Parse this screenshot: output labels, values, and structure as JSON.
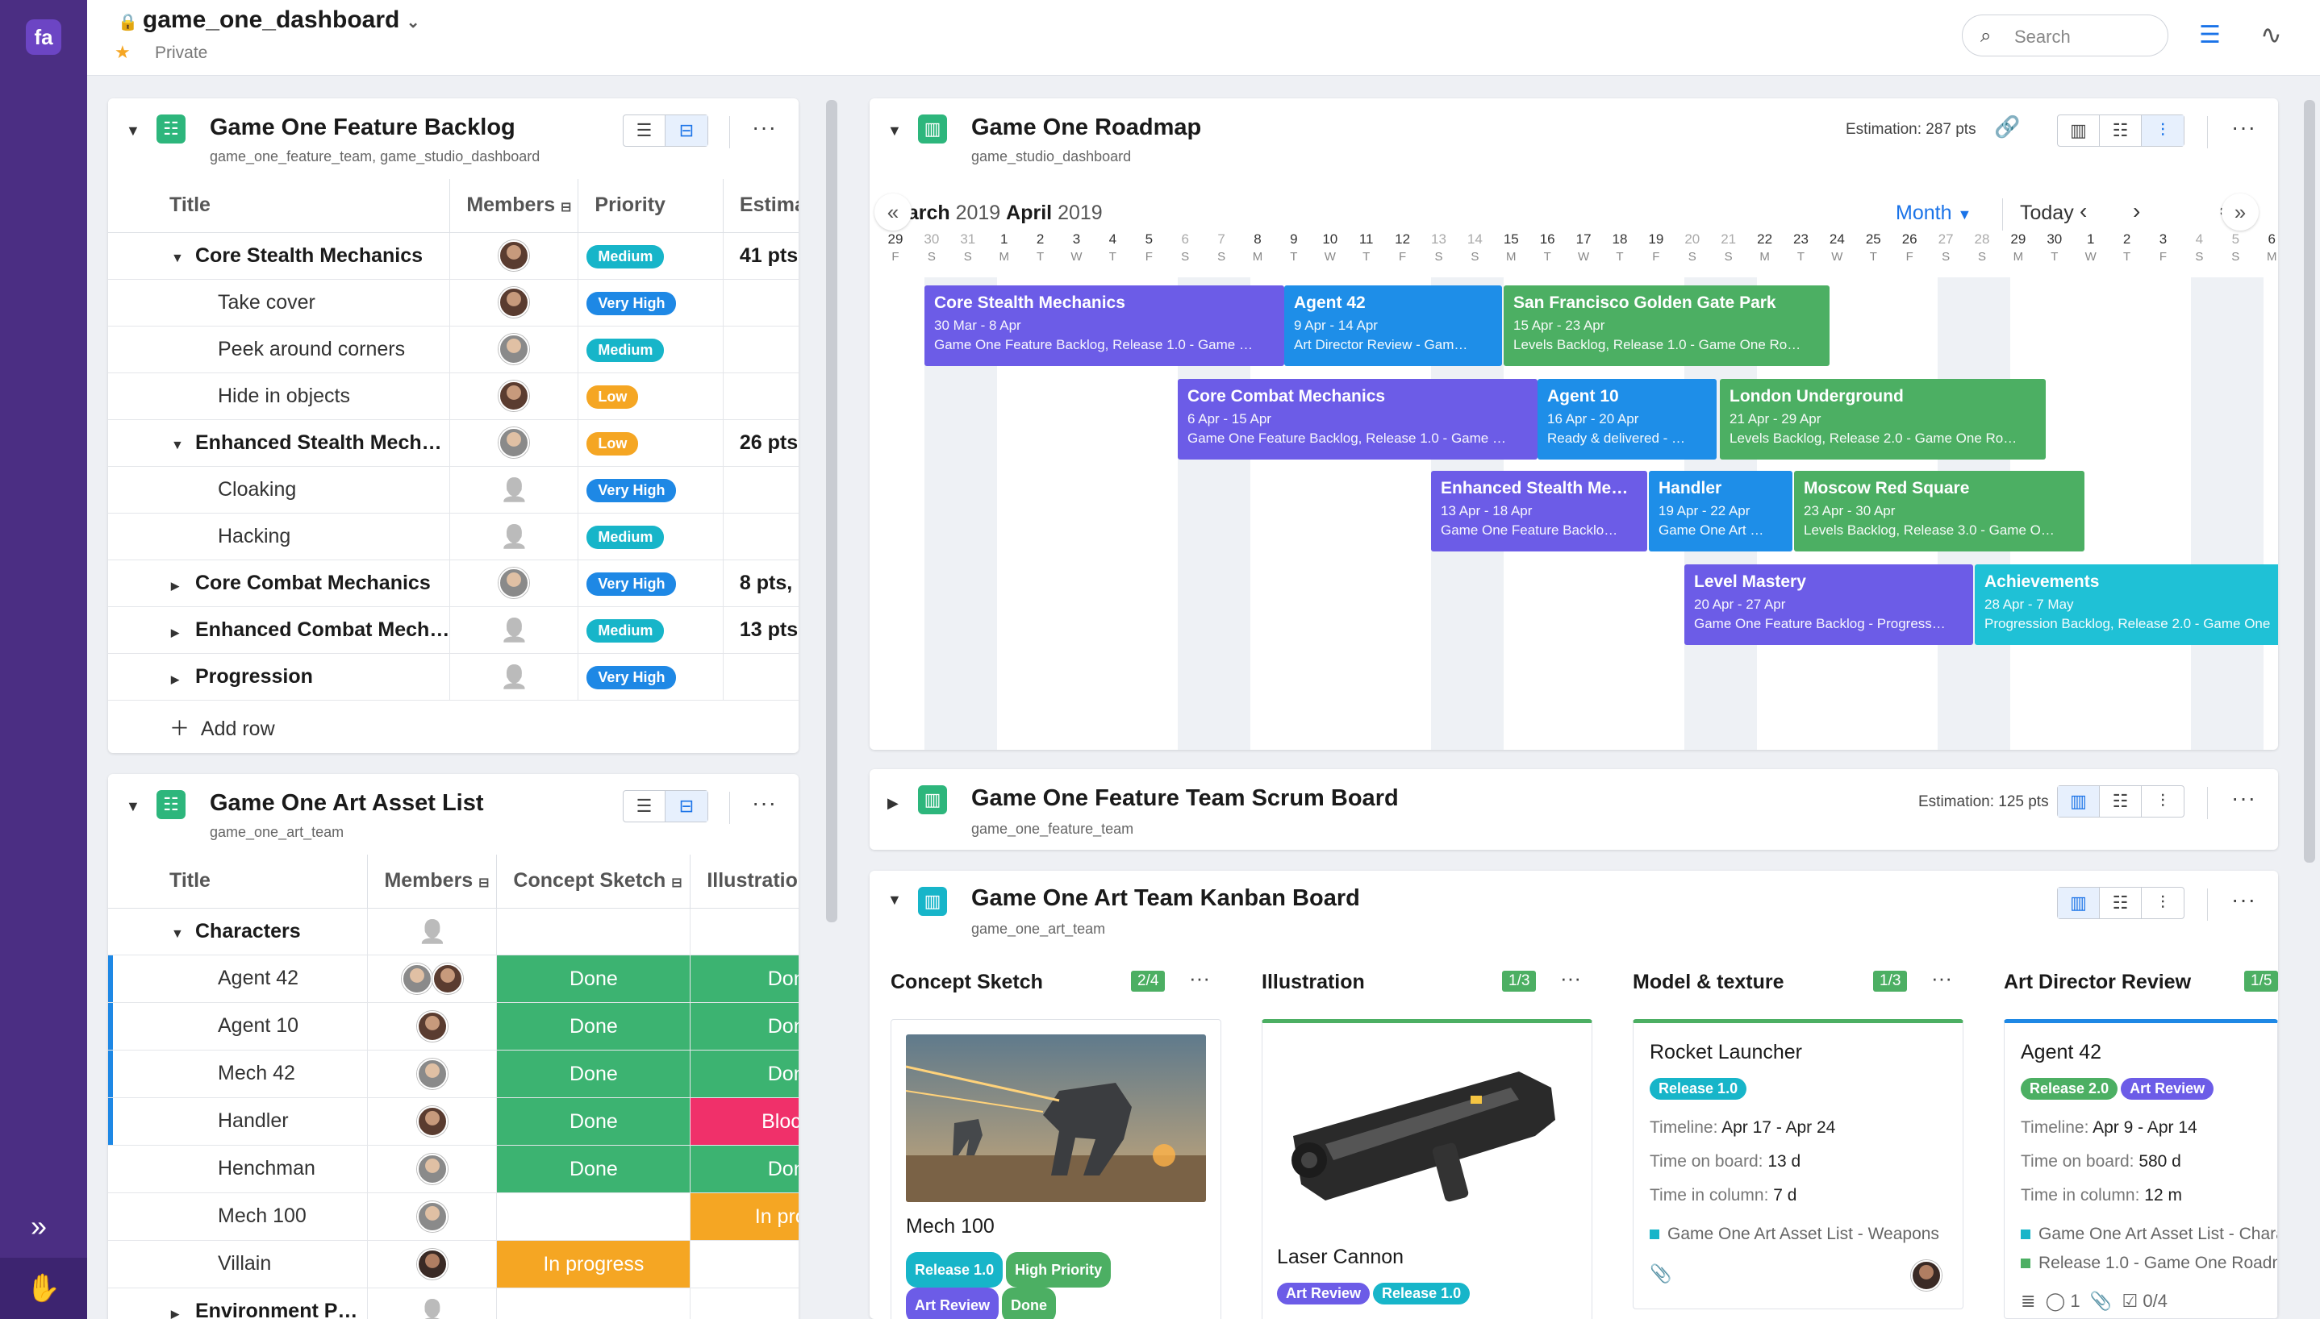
{
  "app": {
    "logo": "fa",
    "dashboard_title": "game_one_dashboard",
    "privacy": "Private",
    "search_placeholder": "Search"
  },
  "backlog": {
    "title": "Game One Feature Backlog",
    "subtitle": "game_one_feature_team, game_studio_dashboard",
    "columns": [
      "Title",
      "Members",
      "Priority",
      "Estimat"
    ],
    "rows": [
      {
        "title": "Core Stealth Mechanics",
        "parent": true,
        "expanded": true,
        "priority": "Medium",
        "est": "41 pts,"
      },
      {
        "title": "Take cover",
        "priority": "Very High"
      },
      {
        "title": "Peek around corners",
        "priority": "Medium"
      },
      {
        "title": "Hide in objects",
        "priority": "Low"
      },
      {
        "title": "Enhanced Stealth Mech…",
        "parent": true,
        "expanded": true,
        "priority": "Low",
        "est": "26 pts,"
      },
      {
        "title": "Cloaking",
        "priority": "Very High"
      },
      {
        "title": "Hacking",
        "priority": "Medium"
      },
      {
        "title": "Core Combat Mechanics",
        "parent": true,
        "priority": "Very High",
        "est": "8 pts,"
      },
      {
        "title": "Enhanced Combat Mech…",
        "parent": true,
        "priority": "Medium",
        "est": "13 pts,"
      },
      {
        "title": "Progression",
        "parent": true,
        "priority": "Very High"
      }
    ],
    "add_row": "Add row"
  },
  "art_list": {
    "title": "Game One Art Asset List",
    "subtitle": "game_one_art_team",
    "columns": [
      "Title",
      "Members",
      "Concept Sketch",
      "Illustration"
    ],
    "rows": [
      {
        "title": "Characters",
        "parent": true,
        "sketch": "",
        "illus": ""
      },
      {
        "title": "Agent 42",
        "sketch": "Done",
        "illus": "Don"
      },
      {
        "title": "Agent 10",
        "sketch": "Done",
        "illus": "Don"
      },
      {
        "title": "Mech 42",
        "sketch": "Done",
        "illus": "Don"
      },
      {
        "title": "Handler",
        "sketch": "Done",
        "illus": "Block"
      },
      {
        "title": "Henchman",
        "sketch": "Done",
        "illus": "Don"
      },
      {
        "title": "Mech 100",
        "sketch": "",
        "illus": "In prog"
      },
      {
        "title": "Villain",
        "sketch": "In progress",
        "illus": ""
      },
      {
        "title": "Environment P…",
        "parent": true,
        "sketch": "",
        "illus": ""
      }
    ]
  },
  "roadmap": {
    "title": "Game One Roadmap",
    "subtitle": "game_studio_dashboard",
    "estimation": "Estimation: 287 pts",
    "month_a": "March",
    "year_a": "2019",
    "month_b": "April",
    "year_b": "2019",
    "scale": "Month",
    "today": "Today",
    "days": [
      [
        "29",
        "F"
      ],
      [
        "30",
        "S"
      ],
      [
        "31",
        "S"
      ],
      [
        "1",
        "M"
      ],
      [
        "2",
        "T"
      ],
      [
        "3",
        "W"
      ],
      [
        "4",
        "T"
      ],
      [
        "5",
        "F"
      ],
      [
        "6",
        "S"
      ],
      [
        "7",
        "S"
      ],
      [
        "8",
        "M"
      ],
      [
        "9",
        "T"
      ],
      [
        "10",
        "W"
      ],
      [
        "11",
        "T"
      ],
      [
        "12",
        "F"
      ],
      [
        "13",
        "S"
      ],
      [
        "14",
        "S"
      ],
      [
        "15",
        "M"
      ],
      [
        "16",
        "T"
      ],
      [
        "17",
        "W"
      ],
      [
        "18",
        "T"
      ],
      [
        "19",
        "F"
      ],
      [
        "20",
        "S"
      ],
      [
        "21",
        "S"
      ],
      [
        "22",
        "M"
      ],
      [
        "23",
        "T"
      ],
      [
        "24",
        "W"
      ],
      [
        "25",
        "T"
      ],
      [
        "26",
        "F"
      ],
      [
        "27",
        "S"
      ],
      [
        "28",
        "S"
      ],
      [
        "29",
        "M"
      ],
      [
        "30",
        "T"
      ],
      [
        "1",
        "W"
      ],
      [
        "2",
        "T"
      ],
      [
        "3",
        "F"
      ],
      [
        "4",
        "S"
      ],
      [
        "5",
        "S"
      ],
      [
        "6",
        "M"
      ]
    ],
    "bars": [
      {
        "title": "Core Stealth Mechanics",
        "dates": "30 Mar - 8 Apr",
        "sub": "Game One Feature Backlog, Release 1.0 - Game …",
        "color": "#6c5ce7"
      },
      {
        "title": "Agent 42",
        "dates": "9 Apr - 14 Apr",
        "sub": "Art Director Review - Gam…",
        "color": "#1e8ee8"
      },
      {
        "title": "San Francisco Golden Gate Park",
        "dates": "15 Apr - 23 Apr",
        "sub": "Levels Backlog, Release 1.0 - Game One Ro…",
        "color": "#4caf63"
      },
      {
        "title": "Core Combat Mechanics",
        "dates": "6 Apr - 15 Apr",
        "sub": "Game One Feature Backlog, Release 1.0 - Game …",
        "color": "#6c5ce7"
      },
      {
        "title": "Agent 10",
        "dates": "16 Apr - 20 Apr",
        "sub": "Ready & delivered - …",
        "color": "#1e8ee8"
      },
      {
        "title": "London Underground",
        "dates": "21 Apr - 29 Apr",
        "sub": "Levels Backlog, Release 2.0 - Game One Ro…",
        "color": "#4caf63"
      },
      {
        "title": "Enhanced Stealth Me…",
        "dates": "13 Apr - 18 Apr",
        "sub": "Game One Feature Backlo…",
        "color": "#6c5ce7"
      },
      {
        "title": "Handler",
        "dates": "19 Apr - 22 Apr",
        "sub": "Game One Art …",
        "color": "#1e8ee8"
      },
      {
        "title": "Moscow Red Square",
        "dates": "23 Apr - 30 Apr",
        "sub": "Levels Backlog, Release 3.0 - Game O…",
        "color": "#4caf63"
      },
      {
        "title": "Level Mastery",
        "dates": "20 Apr - 27 Apr",
        "sub": "Game One Feature Backlog - Progress…",
        "color": "#6c5ce7"
      },
      {
        "title": "Achievements",
        "dates": "28 Apr - 7 May",
        "sub": "Progression Backlog, Release 2.0 - Game One",
        "color": "#1fc1d6"
      }
    ]
  },
  "scrum": {
    "title": "Game One Feature Team Scrum Board",
    "subtitle": "game_one_feature_team",
    "estimation": "Estimation: 125 pts"
  },
  "kanban": {
    "title": "Game One Art Team Kanban Board",
    "subtitle": "game_one_art_team",
    "columns": [
      {
        "title": "Concept Sketch",
        "count": "2/4"
      },
      {
        "title": "Illustration",
        "count": "1/3"
      },
      {
        "title": "Model & texture",
        "count": "1/3"
      },
      {
        "title": "Art Director Review",
        "count": "1/5"
      }
    ],
    "cards": {
      "mech": {
        "name": "Mech 100",
        "tags": [
          "Release 1.0",
          "High Priority",
          "Art Review",
          "Done"
        ]
      },
      "laser": {
        "name": "Laser Cannon",
        "tags": [
          "Art Review",
          "Release 1.0"
        ]
      },
      "rocket": {
        "name": "Rocket Launcher",
        "tags": [
          "Release 1.0"
        ],
        "timeline_label": "Timeline:",
        "timeline": "Apr 17 - Apr 24",
        "board_label": "Time on board:",
        "board": "13 d",
        "column_label": "Time in column:",
        "column": "7 d",
        "link": "Game One Art Asset List - Weapons"
      },
      "agent": {
        "name": "Agent 42",
        "tags": [
          "Release 2.0",
          "Art Review"
        ],
        "timeline_label": "Timeline:",
        "timeline": "Apr 9 - Apr 14",
        "board_label": "Time on board:",
        "board": "580 d",
        "column_label": "Time in column:",
        "column": "12 m",
        "link1": "Game One Art Asset List - Charac",
        "link2": "Release 1.0 - Game One Roadma",
        "comments": "1",
        "checklist": "0/4"
      }
    }
  },
  "colors": {
    "sidebar": "#4b2e83",
    "accent": "#1a73e8",
    "done": "#3cb371",
    "blocked": "#f0306a",
    "in_progress": "#f5a623"
  }
}
